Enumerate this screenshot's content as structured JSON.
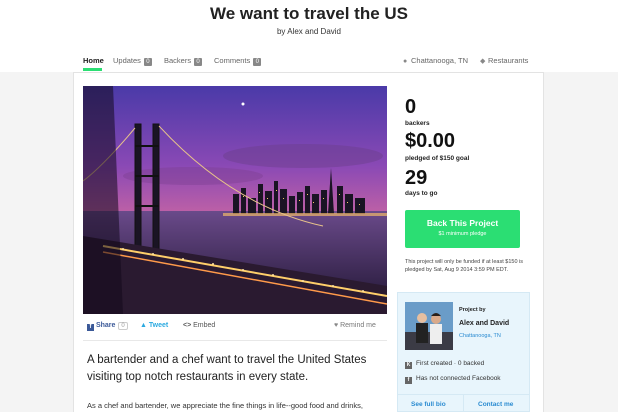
{
  "header": {
    "title": "We want to travel the US",
    "byline": "by Alex and David"
  },
  "tabs": [
    {
      "label": "Home",
      "count": null
    },
    {
      "label": "Updates",
      "count": "0"
    },
    {
      "label": "Backers",
      "count": "0"
    },
    {
      "label": "Comments",
      "count": "0"
    }
  ],
  "meta": {
    "location": "Chattanooga, TN",
    "category": "Restaurants"
  },
  "stats": {
    "backers_value": "0",
    "backers_label": "backers",
    "pledged_value": "$0.00",
    "pledged_label": "pledged of $150 goal",
    "days_value": "29",
    "days_label": "days to go"
  },
  "back_button": {
    "label": "Back This Project",
    "sublabel": "$1 minimum pledge"
  },
  "funding_note": "This project will only be funded if at least $150 is pledged by Sat, Aug 9 2014 3:59 PM EDT.",
  "creator": {
    "project_by_label": "Project by",
    "name": "Alex and David",
    "location": "Chattanooga, TN",
    "first_created": "First created · 0 backed",
    "facebook": "Has not connected Facebook",
    "see_full_bio": "See full bio",
    "contact_me": "Contact me"
  },
  "share": {
    "share_label": "Share",
    "share_count": "0",
    "tweet_label": "Tweet",
    "embed_label": "Embed",
    "remind_label": "Remind me"
  },
  "blurb": "A bartender and a chef want to travel the United States visiting top notch restaurants in every state.",
  "body_text": "As a chef and bartender, we appreciate the fine things in life--good food and drinks,",
  "colors": {
    "accent_green": "#2bde73",
    "link_blue": "#2a8bd1",
    "creator_bg": "#e8f5fc"
  },
  "icons": {
    "location": "map-pin-icon",
    "category": "tag-icon",
    "share": "facebook-icon",
    "tweet": "twitter-bird-icon",
    "embed": "code-brackets-icon",
    "remind": "heart-icon",
    "kickstarter": "kickstarter-k-icon",
    "facebook": "facebook-icon"
  }
}
